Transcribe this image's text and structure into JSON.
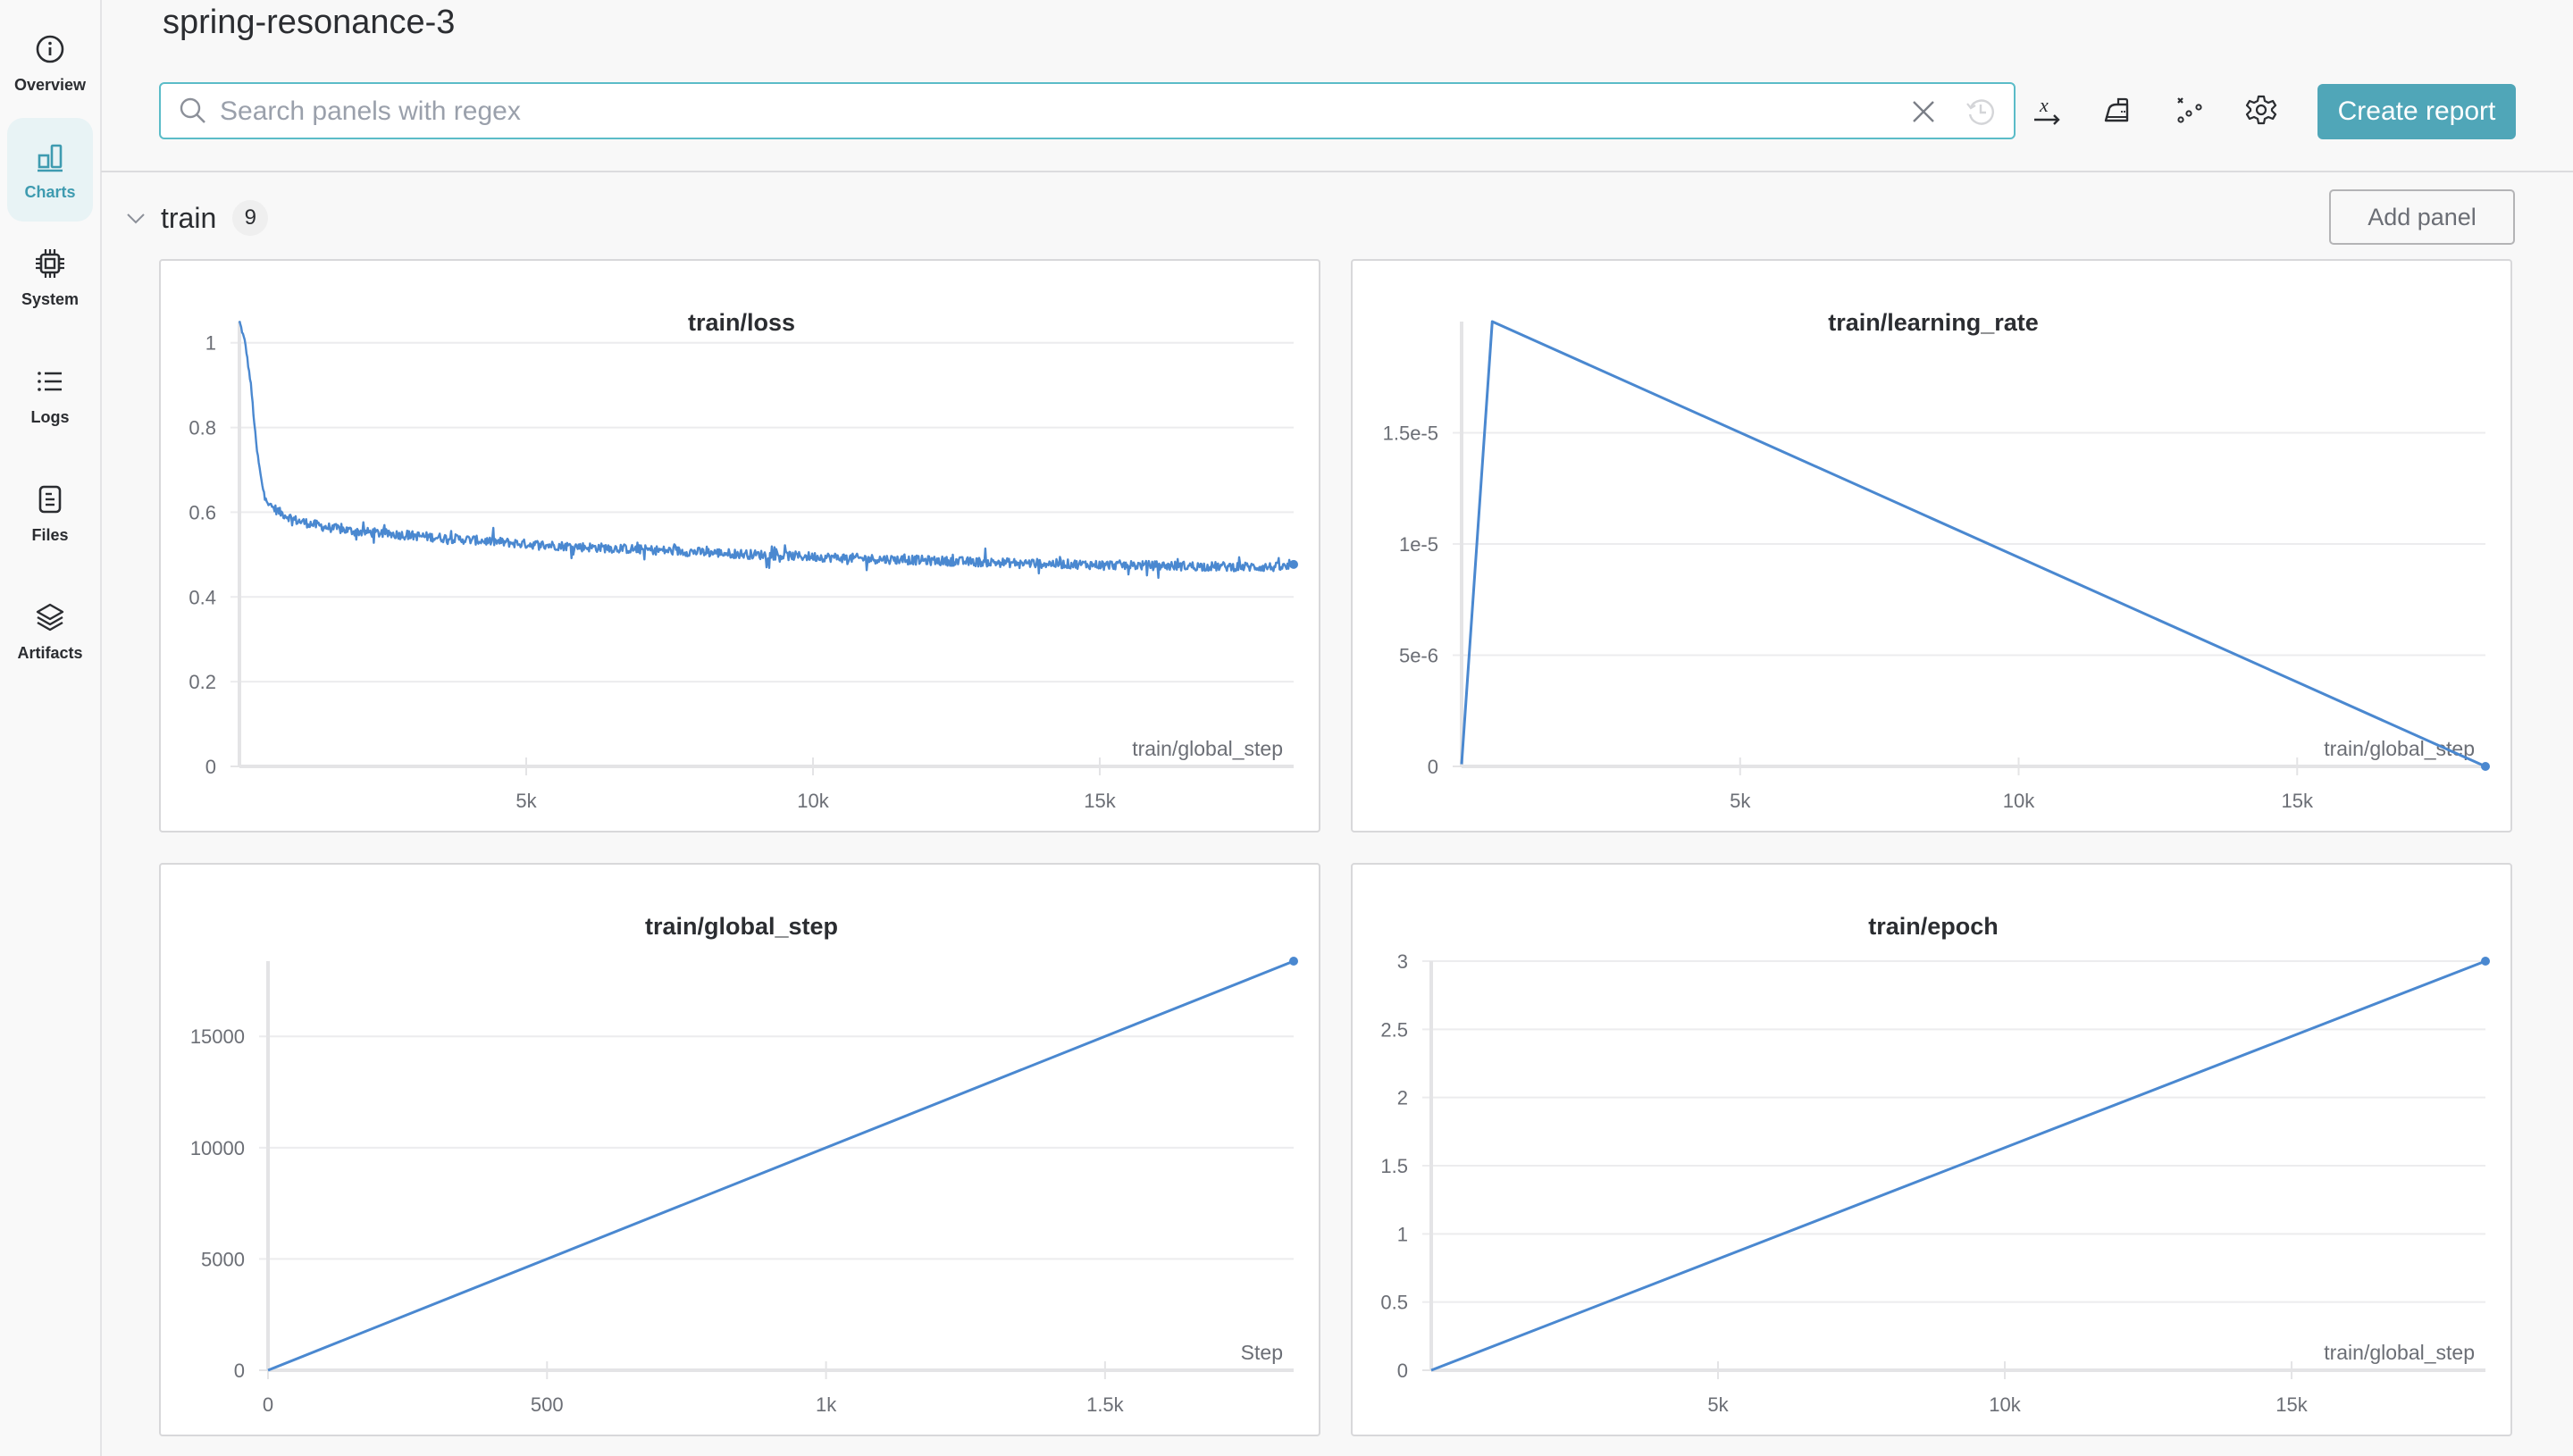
{
  "sidebar": {
    "items": [
      {
        "label": "Overview",
        "icon": "info-icon",
        "active": false
      },
      {
        "label": "Charts",
        "icon": "bar-chart-icon",
        "active": true
      },
      {
        "label": "System",
        "icon": "cpu-chip-icon",
        "active": false
      },
      {
        "label": "Logs",
        "icon": "list-icon",
        "active": false
      },
      {
        "label": "Files",
        "icon": "file-icon",
        "active": false
      },
      {
        "label": "Artifacts",
        "icon": "layers-icon",
        "active": false
      }
    ]
  },
  "header": {
    "run_name": "spring-resonance-3",
    "search": {
      "value": "",
      "placeholder": "Search panels with regex"
    },
    "toolbar": {
      "icons": [
        "x-axis-icon",
        "smoothing-iron-icon",
        "outliers-scatter-icon",
        "settings-gear-icon"
      ],
      "create_report_label": "Create report"
    }
  },
  "section": {
    "name": "train",
    "count": "9",
    "add_panel_label": "Add panel"
  },
  "colors": {
    "accent": "#50a6b8",
    "search_border": "#5bbcc8",
    "series": "#4a88d0"
  },
  "chart_data": [
    {
      "type": "line",
      "title": "train/loss",
      "xlabel": "train/global_step",
      "ylabel": "",
      "xlim": [
        0,
        18380
      ],
      "ylim": [
        0,
        1.05
      ],
      "xticks": [
        5000,
        10000,
        15000
      ],
      "xtick_labels": [
        "5k",
        "10k",
        "15k"
      ],
      "yticks": [
        0,
        0.2,
        0.4,
        0.6,
        0.8,
        1
      ],
      "ytick_labels": [
        "0",
        "0.2",
        "0.4",
        "0.6",
        "0.8",
        "1"
      ],
      "grid": true,
      "series": [
        {
          "name": "spring-resonance-3",
          "noisy": true,
          "x": [
            0,
            100,
            200,
            300,
            400,
            500,
            700,
            1000,
            1500,
            2000,
            3000,
            4000,
            5000,
            6000,
            7000,
            8000,
            9000,
            10000,
            11000,
            12000,
            13000,
            14000,
            15000,
            16000,
            17000,
            18380
          ],
          "y": [
            1.05,
            1.0,
            0.9,
            0.75,
            0.66,
            0.62,
            0.6,
            0.58,
            0.565,
            0.555,
            0.545,
            0.535,
            0.525,
            0.518,
            0.512,
            0.506,
            0.5,
            0.495,
            0.49,
            0.486,
            0.482,
            0.479,
            0.476,
            0.474,
            0.472,
            0.47
          ]
        }
      ]
    },
    {
      "type": "line",
      "title": "train/learning_rate",
      "xlabel": "train/global_step",
      "ylabel": "",
      "xlim": [
        0,
        18380
      ],
      "ylim": [
        0,
        2e-05
      ],
      "xticks": [
        5000,
        10000,
        15000
      ],
      "xtick_labels": [
        "5k",
        "10k",
        "15k"
      ],
      "yticks": [
        0,
        5e-06,
        1e-05,
        1.5e-05
      ],
      "ytick_labels": [
        "0",
        "5e-6",
        "1e-5",
        "1.5e-5"
      ],
      "grid": true,
      "series": [
        {
          "name": "spring-resonance-3",
          "x": [
            0,
            550,
            18380
          ],
          "y": [
            1e-07,
            2e-05,
            0
          ]
        }
      ]
    },
    {
      "type": "line",
      "title": "train/global_step",
      "xlabel": "Step",
      "ylabel": "",
      "xlim": [
        0,
        1838
      ],
      "ylim": [
        0,
        18380
      ],
      "xticks": [
        0,
        500,
        1000,
        1500
      ],
      "xtick_labels": [
        "0",
        "500",
        "1k",
        "1.5k"
      ],
      "yticks": [
        0,
        5000,
        10000,
        15000
      ],
      "ytick_labels": [
        "0",
        "5000",
        "10000",
        "15000"
      ],
      "grid": true,
      "series": [
        {
          "name": "spring-resonance-3",
          "x": [
            0,
            1838
          ],
          "y": [
            0,
            18380
          ]
        }
      ]
    },
    {
      "type": "line",
      "title": "train/epoch",
      "xlabel": "train/global_step",
      "ylabel": "",
      "xlim": [
        0,
        18380
      ],
      "ylim": [
        0,
        3
      ],
      "xticks": [
        5000,
        10000,
        15000
      ],
      "xtick_labels": [
        "5k",
        "10k",
        "15k"
      ],
      "yticks": [
        0,
        0.5,
        1,
        1.5,
        2,
        2.5,
        3
      ],
      "ytick_labels": [
        "0",
        "0.5",
        "1",
        "1.5",
        "2",
        "2.5",
        "3"
      ],
      "grid": true,
      "series": [
        {
          "name": "spring-resonance-3",
          "x": [
            0,
            18380
          ],
          "y": [
            0,
            3
          ]
        }
      ]
    }
  ]
}
